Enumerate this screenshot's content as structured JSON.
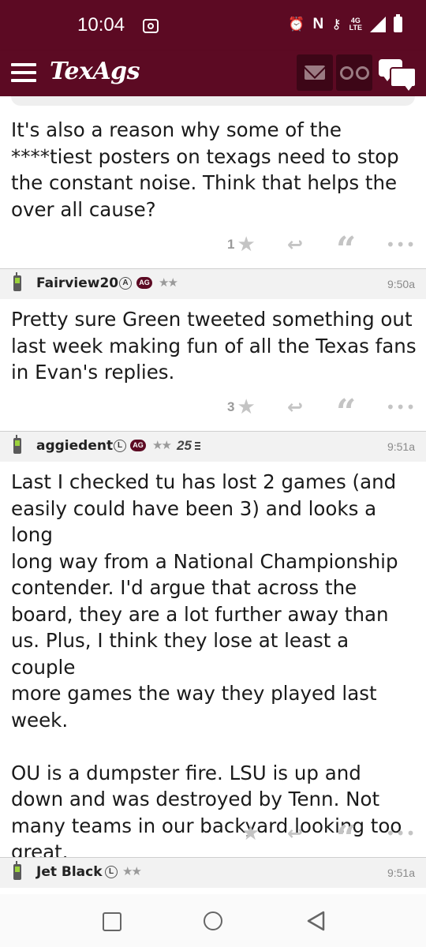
{
  "status_bar": {
    "time": "10:04",
    "network_label_top": "4G",
    "network_label_bottom": "LTE",
    "icons": [
      "screen-record-icon",
      "alarm-icon",
      "nfc-icon",
      "key-icon",
      "signal-icon",
      "battery-icon"
    ]
  },
  "app_bar": {
    "logo": "TexAgs",
    "buttons": [
      "menu-icon",
      "mail-icon",
      "binoculars-icon",
      "chat-icon"
    ],
    "brand_color": "#5c0a23"
  },
  "posts": [
    {
      "body": "It's also a reason why some of the\n****tiest posters on texags need to stop\nthe constant noise. Think that helps the\nover all cause?",
      "like_count": "1"
    },
    {
      "username": "Fairview20",
      "badges": [
        "A",
        "AG"
      ],
      "stars": "★★",
      "time": "9:50a",
      "body": "Pretty sure Green tweeted something out\nlast week making fun of all the Texas fans\nin Evan's replies.",
      "like_count": "3"
    },
    {
      "username": "aggiedent",
      "badges": [
        "L",
        "AG"
      ],
      "stars": "★★",
      "years": "25",
      "time": "9:51a",
      "body": "Last I checked tu has lost 2 games (and\neasily could have been 3) and looks a long\nlong way from a National Championship\ncontender. I'd argue that across the\nboard, they are a lot further away than\nus. Plus, I think they lose at least a couple\nmore games the way they played last\nweek.\n\nOU is a dumpster fire. LSU is up and\ndown and was destroyed by Tenn. Not\nmany teams in our backyard looking too\ngreat.",
      "like_count": ""
    },
    {
      "username": "Jet Black",
      "badges": [
        "L"
      ],
      "stars": "★★",
      "time": "9:51a"
    }
  ],
  "nav_bar": {
    "buttons": [
      "recents-icon",
      "home-icon",
      "back-icon"
    ]
  }
}
